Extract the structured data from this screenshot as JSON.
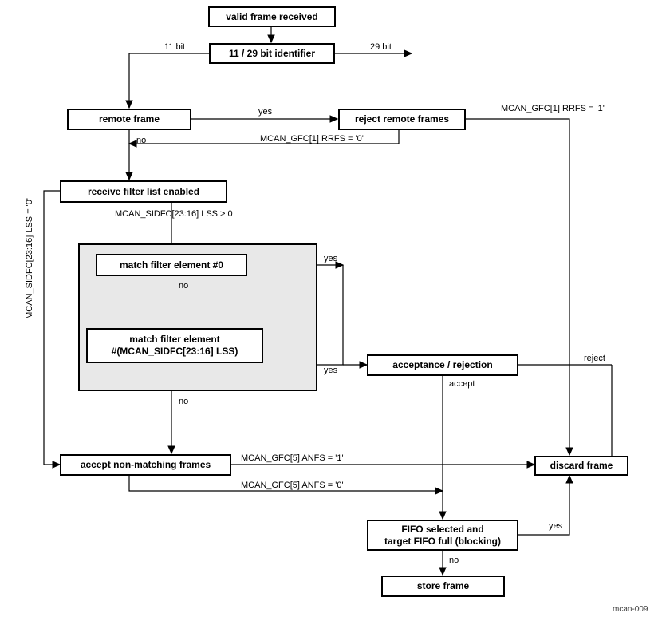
{
  "boxes": {
    "valid_frame": "valid frame received",
    "identifier": "11 / 29 bit identifier",
    "remote_frame": "remote frame",
    "reject_remote": "reject remote frames",
    "filter_list": "receive filter list enabled",
    "match0": "match filter element #0",
    "matchN_l1": "match filter element",
    "matchN_l2": "#(MCAN_SIDFC[23:16] LSS)",
    "accept_reject": "acceptance / rejection",
    "accept_nonmatch": "accept non-matching frames",
    "discard": "discard frame",
    "fifo_l1": "FIFO selected and",
    "fifo_l2": "target FIFO full (blocking)",
    "store": "store frame"
  },
  "labels": {
    "bit11": "11 bit",
    "bit29": "29 bit",
    "yes": "yes",
    "no": "no",
    "rrfs1": "MCAN_GFC[1] RRFS = '1'",
    "rrfs0": "MCAN_GFC[1] RRFS = '0'",
    "lss_gt0": "MCAN_SIDFC[23:16] LSS > 0",
    "lss_eq0": "MCAN_SIDFC[23:16] LSS = '0'",
    "reject": "reject",
    "accept": "accept",
    "anfs1": "MCAN_GFC[5] ANFS = '1'",
    "anfs0": "MCAN_GFC[5] ANFS = '0'"
  },
  "footer": "mcan-009"
}
